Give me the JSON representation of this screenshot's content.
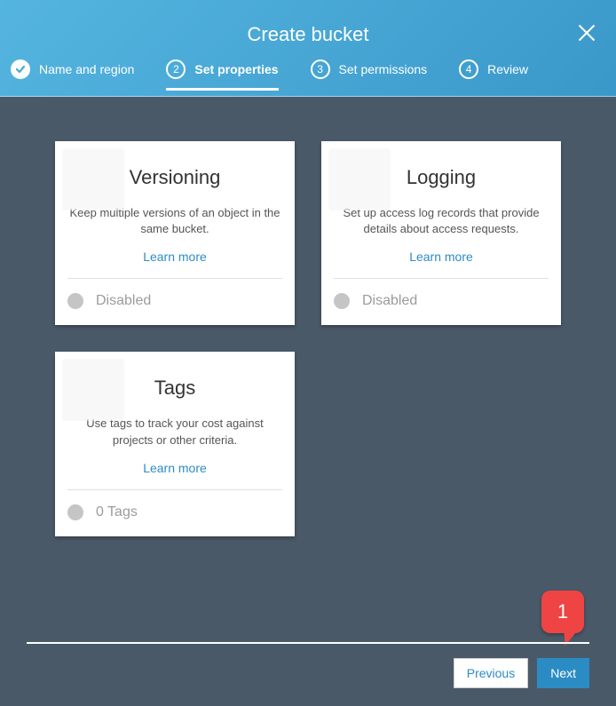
{
  "header": {
    "title": "Create bucket"
  },
  "steps": [
    {
      "num": "",
      "label": "Name and region"
    },
    {
      "num": "2",
      "label": "Set properties"
    },
    {
      "num": "3",
      "label": "Set permissions"
    },
    {
      "num": "4",
      "label": "Review"
    }
  ],
  "cards": {
    "versioning": {
      "title": "Versioning",
      "desc": "Keep multiple versions of an object in the same bucket.",
      "learn": "Learn more",
      "status": "Disabled"
    },
    "logging": {
      "title": "Logging",
      "desc": "Set up access log records that provide details about access requests.",
      "learn": "Learn more",
      "status": "Disabled"
    },
    "tags": {
      "title": "Tags",
      "desc": "Use tags to track your cost against projects or other criteria.",
      "learn": "Learn more",
      "status": "0 Tags"
    }
  },
  "footer": {
    "previous": "Previous",
    "next": "Next"
  },
  "callout": {
    "number": "1"
  }
}
